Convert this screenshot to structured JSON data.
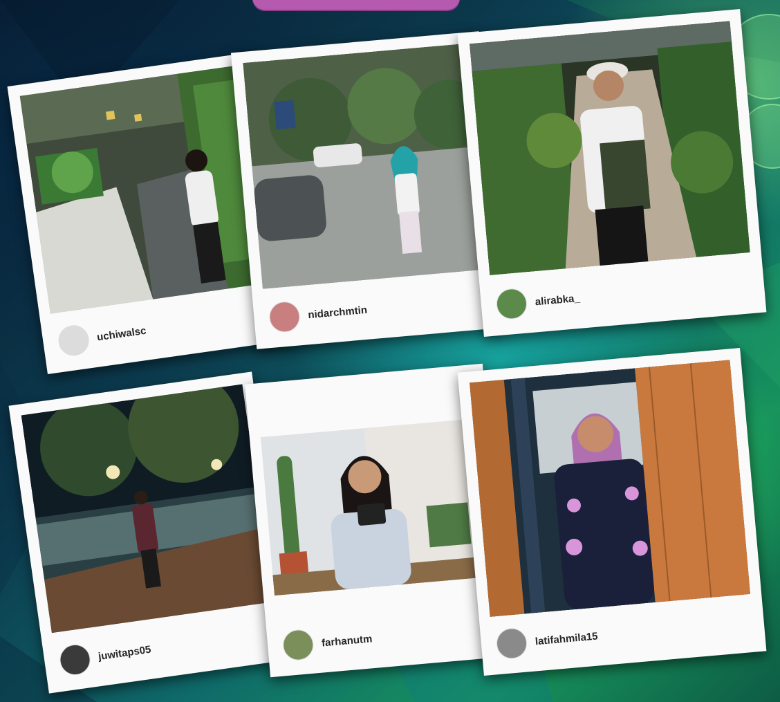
{
  "cards": [
    {
      "username": "uchiwalsc",
      "avatar_color": "#dcdcdc",
      "photo_colors": [
        "#3d4a3a",
        "#7f8f70",
        "#cfcfc8"
      ]
    },
    {
      "username": "nidarchmtin",
      "avatar_color": "#c97f7f",
      "photo_colors": [
        "#6f7a78",
        "#a6aaa5",
        "#5a6b52"
      ]
    },
    {
      "username": "alirabka_",
      "avatar_color": "#5b8a4a",
      "photo_colors": [
        "#2b3a2c",
        "#4f6b3d",
        "#bfb3a2"
      ]
    },
    {
      "username": "juwitaps05",
      "avatar_color": "#3a3a3a",
      "photo_colors": [
        "#0f1a22",
        "#3c5a55",
        "#8a6b4c"
      ]
    },
    {
      "username": "farhanutm",
      "avatar_color": "#7a8f5a",
      "photo_colors": [
        "#e9e6e1",
        "#b9c1c9",
        "#4b6b7a"
      ]
    },
    {
      "username": "latifahmila15",
      "avatar_color": "#8a8a8a",
      "photo_colors": [
        "#b36a32",
        "#1e2f3e",
        "#d28a4a"
      ]
    }
  ],
  "colors": {
    "card_bg": "#fafafa",
    "username_text": "#262626",
    "accent_top": "#b65ab0"
  }
}
